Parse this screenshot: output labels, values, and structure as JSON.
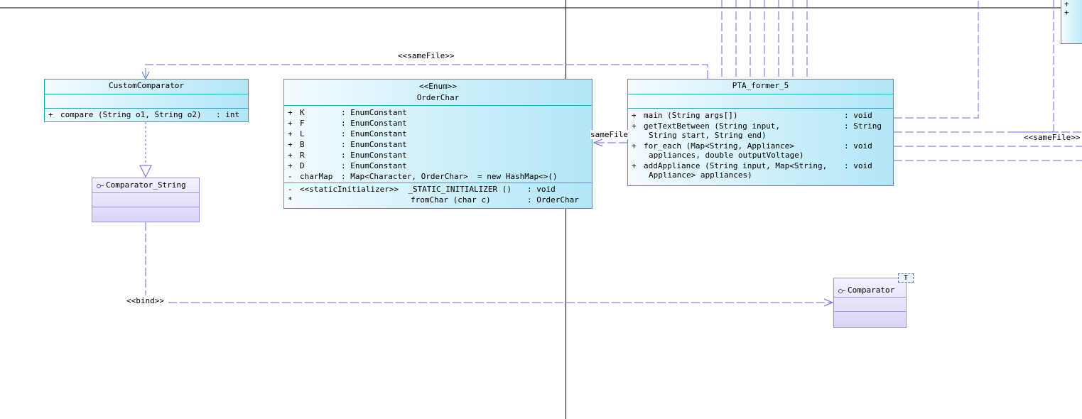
{
  "custom_comparator": {
    "name": "CustomComparator",
    "operation": {
      "vis": "+",
      "sig": "compare (String o1, String o2)",
      "type": ": int"
    }
  },
  "comparator_string": {
    "name": "Comparator_String"
  },
  "order_char": {
    "stereotype": "<<Enum>>",
    "name": "OrderChar",
    "attributes": [
      {
        "vis": "+",
        "name": "K",
        "type": ": EnumConstant"
      },
      {
        "vis": "+",
        "name": "F",
        "type": ": EnumConstant"
      },
      {
        "vis": "+",
        "name": "L",
        "type": ": EnumConstant"
      },
      {
        "vis": "+",
        "name": "B",
        "type": ": EnumConstant"
      },
      {
        "vis": "+",
        "name": "R",
        "type": ": EnumConstant"
      },
      {
        "vis": "+",
        "name": "D",
        "type": ": EnumConstant"
      },
      {
        "vis": "-",
        "name": "charMap",
        "type": ": Map<Character, OrderChar>  = new HashMap<>()"
      }
    ],
    "operations": [
      {
        "vis": "-",
        "name": "<<staticInitializer>>  _STATIC_INITIALIZER ()",
        "type": ": void"
      },
      {
        "vis": "*",
        "name": "fromChar (char c)",
        "type": ": OrderChar"
      }
    ]
  },
  "pta_former_5": {
    "name": "PTA_former_5",
    "operations": [
      {
        "vis": "+",
        "line1": "main (String args[])",
        "line2": "",
        "type": ": void"
      },
      {
        "vis": "+",
        "line1": "getTextBetween (String input,",
        "line2": "String start, String end)",
        "type": ": String"
      },
      {
        "vis": "+",
        "line1": "for_each (Map<String, Appliance>",
        "line2": "appliances, double outputVoltage)",
        "type": ": void"
      },
      {
        "vis": "+",
        "line1": "addAppliance (String input, Map<String,",
        "line2": "Appliance> appliances)",
        "type": ": void"
      }
    ]
  },
  "comparator": {
    "name": "Comparator",
    "type_param": "T"
  },
  "labels": {
    "same_file_top": "<<sameFile>>",
    "same_file_mid": "sameFile",
    "same_file_right": "<<sameFile>>",
    "bind": "<<bind>>"
  },
  "partial_class": {
    "plus1": "+",
    "plus2": "+"
  }
}
